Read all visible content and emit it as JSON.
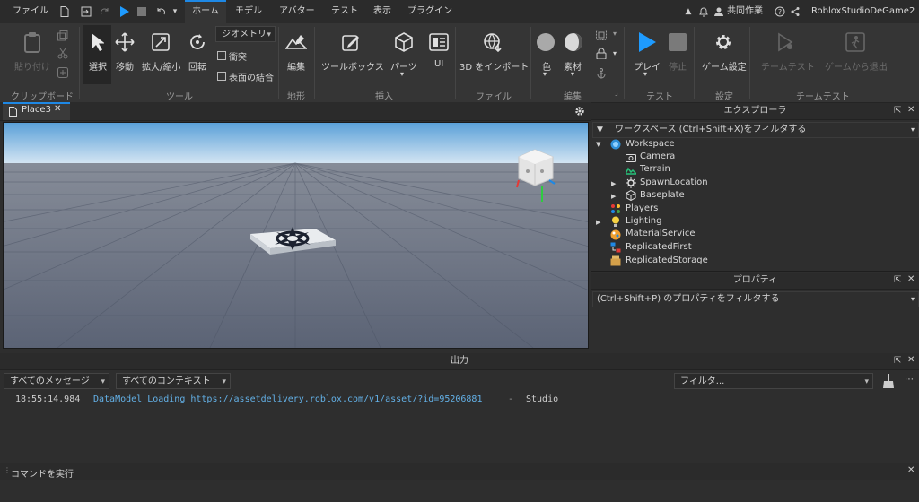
{
  "menubar": {
    "file": "ファイル",
    "tabs": [
      "ホーム",
      "モデル",
      "アバター",
      "テスト",
      "表示",
      "プラグイン"
    ],
    "collaborate": "共同作業",
    "project_name": "RobloxStudioDeGame2"
  },
  "ribbon": {
    "paste": "貼り付け",
    "select": "選択",
    "move": "移動",
    "scale": "拡大/縮小",
    "rotate": "回転",
    "geometry_dropdown": "ジオメトリ",
    "collisions": "衝突",
    "join_surfaces": "表面の結合",
    "terrain_edit": "編集",
    "toolbox": "ツールボックス",
    "parts": "パーツ",
    "ui": "UI",
    "import3d": "3D をインポート",
    "color": "色",
    "material": "素材",
    "play": "プレイ",
    "stop": "停止",
    "game_settings": "ゲーム設定",
    "team_test": "チームテスト",
    "exit_game": "ゲームから退出",
    "groups": {
      "clipboard": "クリップボード",
      "tools": "ツール",
      "terrain": "地形",
      "insert": "挿入",
      "file": "ファイル",
      "edit": "編集",
      "test": "テスト",
      "settings": "設定",
      "team_test": "チームテスト"
    }
  },
  "viewport": {
    "tab_title": "Place3"
  },
  "explorer": {
    "title": "エクスプローラ",
    "filter_placeholder": "ワークスペース (Ctrl+Shift+X)をフィルタする",
    "items": [
      {
        "label": "Workspace",
        "icon": "workspace-icon",
        "expanded": true
      },
      {
        "label": "Camera",
        "icon": "camera-icon"
      },
      {
        "label": "Terrain",
        "icon": "terrain-icon"
      },
      {
        "label": "SpawnLocation",
        "icon": "spawn-icon"
      },
      {
        "label": "Baseplate",
        "icon": "part-icon"
      },
      {
        "label": "Players",
        "icon": "players-icon"
      },
      {
        "label": "Lighting",
        "icon": "lighting-icon"
      },
      {
        "label": "MaterialService",
        "icon": "material-service-icon"
      },
      {
        "label": "ReplicatedFirst",
        "icon": "replicated-first-icon"
      },
      {
        "label": "ReplicatedStorage",
        "icon": "replicated-storage-icon"
      }
    ]
  },
  "properties": {
    "title": "プロパティ",
    "filter_placeholder": "(Ctrl+Shift+P) のプロパティをフィルタする"
  },
  "output": {
    "title": "出力",
    "messages_dropdown": "すべてのメッセージ",
    "contexts_dropdown": "すべてのコンテキスト",
    "filter_placeholder": "フィルタ...",
    "log": {
      "time": "18:55:14.984",
      "message": "DataModel Loading https://assetdelivery.roblox.com/v1/asset/?id=95206881",
      "separator": "-",
      "source": "Studio"
    }
  },
  "command_bar": {
    "label": "コマンドを実行"
  },
  "colors": {
    "accent": "#1e88e5",
    "play_blue": "#1e9bff",
    "log_blue": "#63b0e6",
    "sky_top": "#5aa0d8",
    "ground": "#5d6679"
  }
}
